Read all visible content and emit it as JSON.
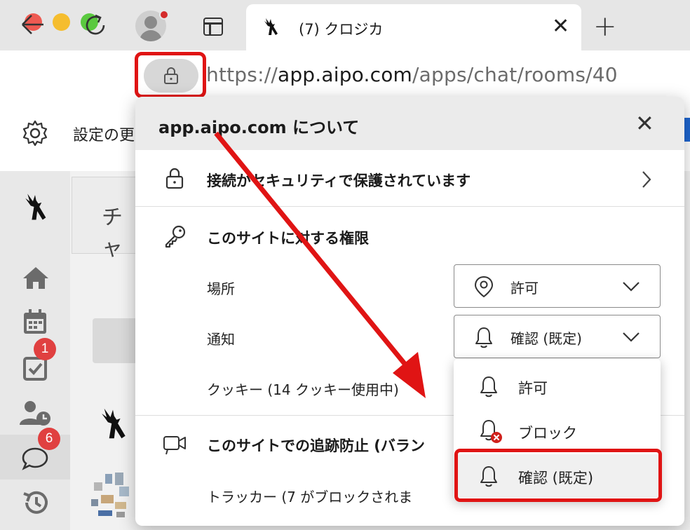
{
  "browser": {
    "tab": {
      "title": "(7) クロジカ",
      "close": "✕"
    },
    "new_tab": "+",
    "address": {
      "scheme": "https://",
      "domain": "app.aipo.com",
      "path": "/apps/chat/rooms/40"
    },
    "settings_label": "設定の更"
  },
  "app": {
    "chat_header": "チャ",
    "badges": {
      "tasks": "1",
      "chat": "6"
    }
  },
  "popup": {
    "title": "app.aipo.com について",
    "close": "✕",
    "connection": "接続がセキュリティで保護されています",
    "permissions_heading": "このサイトに対する権限",
    "location": {
      "label": "場所",
      "value": "許可"
    },
    "notifications": {
      "label": "通知",
      "value": "確認 (既定)"
    },
    "cookies": "クッキー (14 クッキー使用中)",
    "tracking": "このサイトでの追跡防止 (バラン",
    "trackers": "トラッカー (7 がブロックされま",
    "menu": {
      "allow": "許可",
      "block": "ブロック",
      "ask": "確認 (既定)"
    }
  },
  "colors": {
    "annotation": "#e01414",
    "badge": "#e04040"
  }
}
